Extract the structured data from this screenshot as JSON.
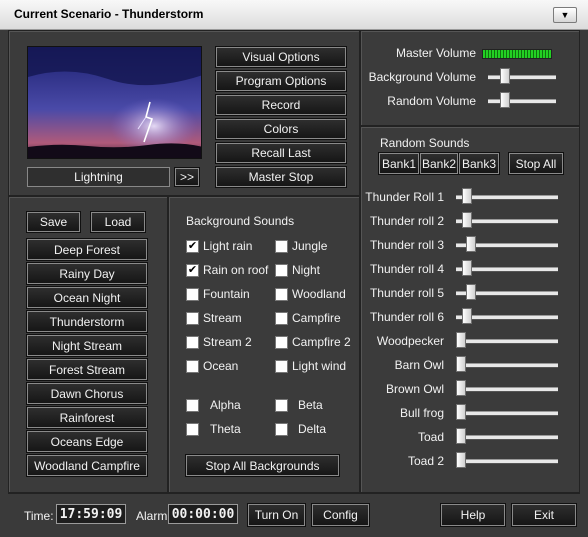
{
  "window": {
    "title": "Current Scenario - Thunderstorm",
    "menu_glyph": "▼"
  },
  "preview": {
    "caption": "Lightning",
    "next_label": ">>"
  },
  "options": {
    "visual": "Visual Options",
    "program": "Program Options",
    "record": "Record",
    "colors": "Colors",
    "recall_last": "Recall Last",
    "master_stop": "Master Stop"
  },
  "scenarios": {
    "save": "Save",
    "load": "Load",
    "items": [
      "Deep Forest",
      "Rainy Day",
      "Ocean Night",
      "Thunderstorm",
      "Night Stream",
      "Forest Stream",
      "Dawn Chorus",
      "Rainforest",
      "Oceans Edge",
      "Woodland Campfire"
    ]
  },
  "background_sounds": {
    "title": "Background Sounds",
    "items": [
      {
        "label": "Light rain",
        "checked": true
      },
      {
        "label": "Jungle",
        "checked": false
      },
      {
        "label": "Rain on roof",
        "checked": true
      },
      {
        "label": "Night",
        "checked": false
      },
      {
        "label": "Fountain",
        "checked": false
      },
      {
        "label": "Woodland",
        "checked": false
      },
      {
        "label": "Stream",
        "checked": false
      },
      {
        "label": "Campfire",
        "checked": false
      },
      {
        "label": "Stream 2",
        "checked": false
      },
      {
        "label": "Campfire 2",
        "checked": false
      },
      {
        "label": "Ocean",
        "checked": false
      },
      {
        "label": "Light wind",
        "checked": false
      },
      {
        "label": "Alpha",
        "checked": false
      },
      {
        "label": "Beta",
        "checked": false
      },
      {
        "label": "Theta",
        "checked": false
      },
      {
        "label": "Delta",
        "checked": false
      }
    ],
    "stop_all": "Stop All Backgrounds"
  },
  "volumes": {
    "master": {
      "label": "Master Volume"
    },
    "background": {
      "label": "Background Volume",
      "level": 0.2
    },
    "random": {
      "label": "Random Volume",
      "level": 0.2
    }
  },
  "random_sounds": {
    "title": "Random Sounds",
    "banks": [
      "Bank1",
      "Bank2",
      "Bank3"
    ],
    "stop_all": "Stop All",
    "items": [
      {
        "label": "Thunder Roll 1",
        "level": 0.07
      },
      {
        "label": "Thunder roll 2",
        "level": 0.07
      },
      {
        "label": "Thunder roll 3",
        "level": 0.11
      },
      {
        "label": "Thunder roll 4",
        "level": 0.07
      },
      {
        "label": "Thunder roll 5",
        "level": 0.11
      },
      {
        "label": "Thunder roll 6",
        "level": 0.07
      },
      {
        "label": "Woodpecker",
        "level": 0.0
      },
      {
        "label": "Barn Owl",
        "level": 0.0
      },
      {
        "label": "Brown Owl",
        "level": 0.0
      },
      {
        "label": "Bull frog",
        "level": 0.0
      },
      {
        "label": "Toad",
        "level": 0.0
      },
      {
        "label": "Toad 2",
        "level": 0.0
      }
    ]
  },
  "footer": {
    "time_label": "Time:",
    "time_value": "17:59:09",
    "alarm_label": "Alarm:",
    "alarm_value": "00:00:00",
    "turn_on": "Turn On",
    "config": "Config",
    "help": "Help",
    "exit": "Exit"
  }
}
